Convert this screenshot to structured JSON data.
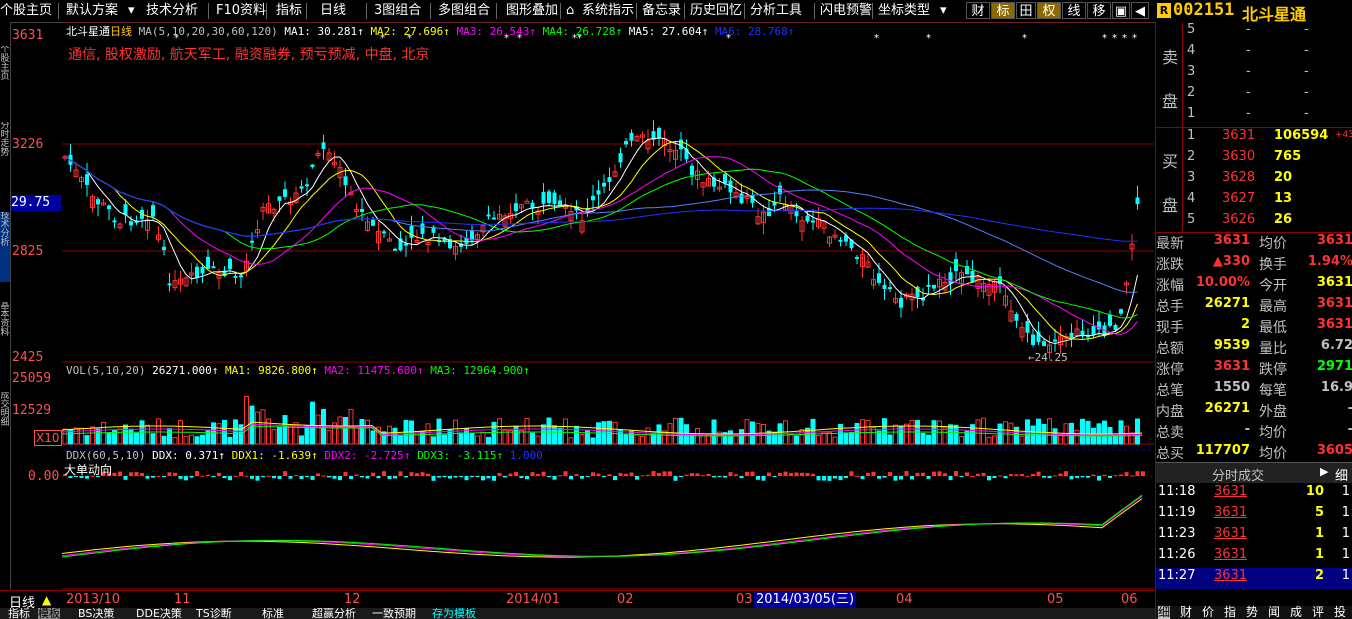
{
  "menu": {
    "items": [
      "个股主页",
      "默认方案",
      "技术分析",
      "F10资料",
      "指标",
      "日线",
      "3图组合",
      "多图组合",
      "图形叠加",
      "系统指示",
      "备忘录",
      "历史回忆",
      "分析工具",
      "闪电预警",
      "坐标类型"
    ],
    "right_buttons": [
      "财",
      "标",
      "田",
      "权",
      "线",
      "移"
    ],
    "window_icons": [
      "◀",
      "▶"
    ]
  },
  "stock": {
    "code": "002151",
    "name": "北斗星通",
    "badge": "R"
  },
  "left_tabs": [
    "个股主页",
    "分时走势",
    "技术分析",
    "基本资料",
    "成交明细"
  ],
  "price_axis": {
    "labels": [
      "3631",
      "3226",
      "2825",
      "2425"
    ],
    "current": "29.75"
  },
  "main_legend": {
    "name": "北斗星通",
    "period": "日线",
    "ma": "MA(5,10,20,30,60,120)",
    "ma1": "MA1: 30.281",
    "ma2": "MA2: 27.696",
    "ma3": "MA3: 26.543",
    "ma4": "MA4: 26.728",
    "ma5": "MA5: 27.604",
    "ma6": "MA6: 28.768",
    "concepts": "通信, 股权激励, 航天军工, 融资融券, 预亏预减, 中盘, 北京",
    "low_label": "24.25"
  },
  "vol_axis": {
    "labels": [
      "25059",
      "12529",
      "X10"
    ]
  },
  "vol_legend": {
    "name": "VOL(5,10,20)",
    "value": "26271.000",
    "ma1": "MA1: 9826.800",
    "ma2": "MA2: 11475.600",
    "ma3": "MA3: 12964.900"
  },
  "ddx_axis": {
    "labels": [
      "0.00"
    ]
  },
  "ddx_legend": {
    "name": "DDX(60,5,10)",
    "ddx": "DDX: 0.371",
    "ddx1": "DDX1: -1.639",
    "ddx2": "DDX2: -2.725",
    "ddx3": "DDX3: -3.115",
    "extra": "1.000",
    "title2": "大单动向"
  },
  "date_axis": {
    "period": "日线",
    "labels": [
      "2013/10",
      "11",
      "12",
      "2014/01",
      "02",
      "03",
      "04",
      "05",
      "06"
    ],
    "cursor": "2014/03/05(三)"
  },
  "orderbook": {
    "sell_label": [
      "卖",
      "盘"
    ],
    "buy_label": [
      "买",
      "盘"
    ],
    "sell": [
      [
        "5",
        "-",
        "-"
      ],
      [
        "4",
        "-",
        "-"
      ],
      [
        "3",
        "-",
        "-"
      ],
      [
        "2",
        "-",
        "-"
      ],
      [
        "1",
        "-",
        "-"
      ]
    ],
    "buy": [
      [
        "1",
        "3631",
        "106594",
        "+43"
      ],
      [
        "2",
        "3630",
        "765",
        ""
      ],
      [
        "3",
        "3628",
        "20",
        ""
      ],
      [
        "4",
        "3627",
        "13",
        ""
      ],
      [
        "5",
        "3626",
        "26",
        ""
      ]
    ]
  },
  "quote": [
    {
      "l1": "最新",
      "v1": "3631",
      "l2": "均价",
      "v2": "3631"
    },
    {
      "l1": "涨跌",
      "v1": "▲330",
      "l2": "换手",
      "v2": "1.94%"
    },
    {
      "l1": "涨幅",
      "v1": "10.00%",
      "l2": "今开",
      "v2": "3631"
    },
    {
      "l1": "总手",
      "v1": "26271",
      "l2": "最高",
      "v2": "3631"
    },
    {
      "l1": "现手",
      "v1": "2",
      "l2": "最低",
      "v2": "3631"
    },
    {
      "l1": "总额",
      "v1": "9539",
      "l2": "量比",
      "v2": "6.72"
    },
    {
      "l1": "涨停",
      "v1": "3631",
      "l2": "跌停",
      "v2": "2971"
    },
    {
      "l1": "总笔",
      "v1": "1550",
      "l2": "每笔",
      "v2": "16.9"
    },
    {
      "l1": "内盘",
      "v1": "26271",
      "l2": "外盘",
      "v2": "-"
    },
    {
      "l1": "总卖",
      "v1": "-",
      "l2": "均价",
      "v2": "-"
    },
    {
      "l1": "总买",
      "v1": "117707",
      "l2": "均价",
      "v2": "3605"
    }
  ],
  "ticks_header": {
    "title": "分时成交",
    "btn": "细"
  },
  "ticks": [
    {
      "time": "11:18",
      "price": "3631",
      "vol": "10",
      "n": "1"
    },
    {
      "time": "11:19",
      "price": "3631",
      "vol": "5",
      "n": "1"
    },
    {
      "time": "11:23",
      "price": "3631",
      "vol": "1",
      "n": "1"
    },
    {
      "time": "11:26",
      "price": "3631",
      "vol": "1",
      "n": "1"
    },
    {
      "time": "11:27",
      "price": "3631",
      "vol": "2",
      "n": "1"
    }
  ],
  "right_tabs": [
    "细",
    "财",
    "价",
    "指",
    "势",
    "闻",
    "成",
    "评",
    "投"
  ],
  "bottom_tabs": [
    "指标",
    "模板",
    "BS决策",
    "DDE决策",
    "TS诊断",
    "标准",
    "超赢分析",
    "一致预期",
    "存为模板"
  ],
  "colors": {
    "up": "#ff3232",
    "down": "#00ffff",
    "ma1": "#ffffff",
    "ma2": "#ffff00",
    "ma3": "#ff00ff",
    "ma4": "#00ff00",
    "ma5": "#5080ff",
    "ma6": "#2030ff",
    "grid": "#8b0000"
  }
}
